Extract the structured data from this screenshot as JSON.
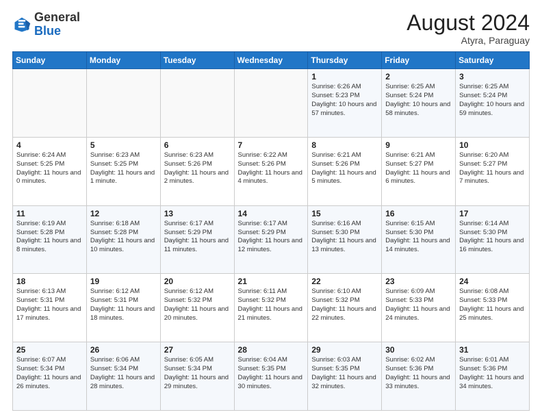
{
  "header": {
    "logo_general": "General",
    "logo_blue": "Blue",
    "month_year": "August 2024",
    "location": "Atyra, Paraguay"
  },
  "days_of_week": [
    "Sunday",
    "Monday",
    "Tuesday",
    "Wednesday",
    "Thursday",
    "Friday",
    "Saturday"
  ],
  "weeks": [
    [
      {
        "day": "",
        "info": ""
      },
      {
        "day": "",
        "info": ""
      },
      {
        "day": "",
        "info": ""
      },
      {
        "day": "",
        "info": ""
      },
      {
        "day": "1",
        "info": "Sunrise: 6:26 AM\nSunset: 5:23 PM\nDaylight: 10 hours and 57 minutes."
      },
      {
        "day": "2",
        "info": "Sunrise: 6:25 AM\nSunset: 5:24 PM\nDaylight: 10 hours and 58 minutes."
      },
      {
        "day": "3",
        "info": "Sunrise: 6:25 AM\nSunset: 5:24 PM\nDaylight: 10 hours and 59 minutes."
      }
    ],
    [
      {
        "day": "4",
        "info": "Sunrise: 6:24 AM\nSunset: 5:25 PM\nDaylight: 11 hours and 0 minutes."
      },
      {
        "day": "5",
        "info": "Sunrise: 6:23 AM\nSunset: 5:25 PM\nDaylight: 11 hours and 1 minute."
      },
      {
        "day": "6",
        "info": "Sunrise: 6:23 AM\nSunset: 5:26 PM\nDaylight: 11 hours and 2 minutes."
      },
      {
        "day": "7",
        "info": "Sunrise: 6:22 AM\nSunset: 5:26 PM\nDaylight: 11 hours and 4 minutes."
      },
      {
        "day": "8",
        "info": "Sunrise: 6:21 AM\nSunset: 5:26 PM\nDaylight: 11 hours and 5 minutes."
      },
      {
        "day": "9",
        "info": "Sunrise: 6:21 AM\nSunset: 5:27 PM\nDaylight: 11 hours and 6 minutes."
      },
      {
        "day": "10",
        "info": "Sunrise: 6:20 AM\nSunset: 5:27 PM\nDaylight: 11 hours and 7 minutes."
      }
    ],
    [
      {
        "day": "11",
        "info": "Sunrise: 6:19 AM\nSunset: 5:28 PM\nDaylight: 11 hours and 8 minutes."
      },
      {
        "day": "12",
        "info": "Sunrise: 6:18 AM\nSunset: 5:28 PM\nDaylight: 11 hours and 10 minutes."
      },
      {
        "day": "13",
        "info": "Sunrise: 6:17 AM\nSunset: 5:29 PM\nDaylight: 11 hours and 11 minutes."
      },
      {
        "day": "14",
        "info": "Sunrise: 6:17 AM\nSunset: 5:29 PM\nDaylight: 11 hours and 12 minutes."
      },
      {
        "day": "15",
        "info": "Sunrise: 6:16 AM\nSunset: 5:30 PM\nDaylight: 11 hours and 13 minutes."
      },
      {
        "day": "16",
        "info": "Sunrise: 6:15 AM\nSunset: 5:30 PM\nDaylight: 11 hours and 14 minutes."
      },
      {
        "day": "17",
        "info": "Sunrise: 6:14 AM\nSunset: 5:30 PM\nDaylight: 11 hours and 16 minutes."
      }
    ],
    [
      {
        "day": "18",
        "info": "Sunrise: 6:13 AM\nSunset: 5:31 PM\nDaylight: 11 hours and 17 minutes."
      },
      {
        "day": "19",
        "info": "Sunrise: 6:12 AM\nSunset: 5:31 PM\nDaylight: 11 hours and 18 minutes."
      },
      {
        "day": "20",
        "info": "Sunrise: 6:12 AM\nSunset: 5:32 PM\nDaylight: 11 hours and 20 minutes."
      },
      {
        "day": "21",
        "info": "Sunrise: 6:11 AM\nSunset: 5:32 PM\nDaylight: 11 hours and 21 minutes."
      },
      {
        "day": "22",
        "info": "Sunrise: 6:10 AM\nSunset: 5:32 PM\nDaylight: 11 hours and 22 minutes."
      },
      {
        "day": "23",
        "info": "Sunrise: 6:09 AM\nSunset: 5:33 PM\nDaylight: 11 hours and 24 minutes."
      },
      {
        "day": "24",
        "info": "Sunrise: 6:08 AM\nSunset: 5:33 PM\nDaylight: 11 hours and 25 minutes."
      }
    ],
    [
      {
        "day": "25",
        "info": "Sunrise: 6:07 AM\nSunset: 5:34 PM\nDaylight: 11 hours and 26 minutes."
      },
      {
        "day": "26",
        "info": "Sunrise: 6:06 AM\nSunset: 5:34 PM\nDaylight: 11 hours and 28 minutes."
      },
      {
        "day": "27",
        "info": "Sunrise: 6:05 AM\nSunset: 5:34 PM\nDaylight: 11 hours and 29 minutes."
      },
      {
        "day": "28",
        "info": "Sunrise: 6:04 AM\nSunset: 5:35 PM\nDaylight: 11 hours and 30 minutes."
      },
      {
        "day": "29",
        "info": "Sunrise: 6:03 AM\nSunset: 5:35 PM\nDaylight: 11 hours and 32 minutes."
      },
      {
        "day": "30",
        "info": "Sunrise: 6:02 AM\nSunset: 5:36 PM\nDaylight: 11 hours and 33 minutes."
      },
      {
        "day": "31",
        "info": "Sunrise: 6:01 AM\nSunset: 5:36 PM\nDaylight: 11 hours and 34 minutes."
      }
    ]
  ]
}
